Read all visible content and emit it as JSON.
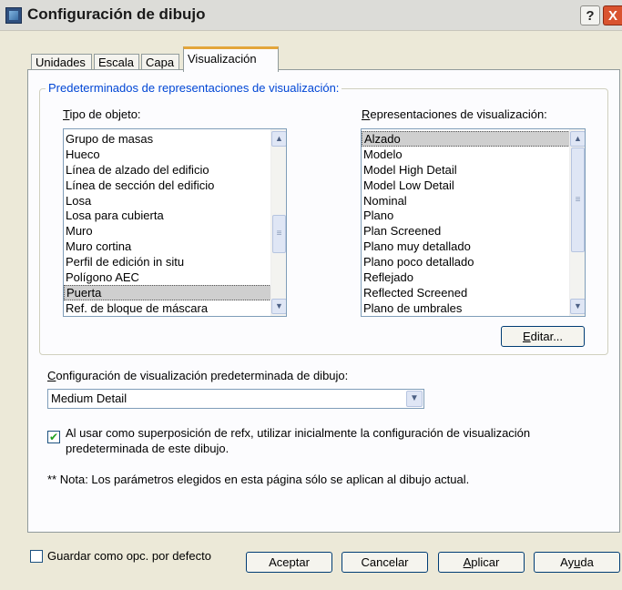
{
  "window": {
    "title": "Configuración de dibujo",
    "help_glyph": "?",
    "close_glyph": "X"
  },
  "tabs": [
    {
      "label": "Unidades",
      "active": false
    },
    {
      "label": "Escala",
      "active": false
    },
    {
      "label": "Capa",
      "active": false
    },
    {
      "label": "Visualización",
      "active": true
    }
  ],
  "group": {
    "title": "Predeterminados de representaciones de visualización:",
    "object_type_label": "Tipo de objeto:",
    "object_types": [
      "Grupo de masas",
      "Hueco",
      "Línea de alzado del edificio",
      "Línea de sección del edificio",
      "Losa",
      "Losa para cubierta",
      "Muro",
      "Muro cortina",
      "Perfil de edición in situ",
      "Polígono AEC",
      "Puerta",
      "Ref. de bloque de máscara"
    ],
    "object_type_selected_index": 10,
    "display_reps_label": "Representaciones de visualización:",
    "display_reps": [
      "Alzado",
      "Modelo",
      "Model High Detail",
      "Model Low Detail",
      "Nominal",
      "Plano",
      "Plan Screened",
      "Plano muy detallado",
      "Plano poco detallado",
      "Reflejado",
      "Reflected Screened",
      "Plano de umbrales"
    ],
    "display_rep_selected_index": 0,
    "edit_button": "Editar..."
  },
  "default_config": {
    "label": "Configuración de visualización predeterminada de dibujo:",
    "value": "Medium Detail"
  },
  "xref_checkbox": {
    "checked": true,
    "line1": "Al usar como superposición de refx, utilizar inicialmente la configuración de visualización",
    "line2": "predeterminada de este dibujo."
  },
  "note": "** Nota: Los parámetros elegidos en esta página sólo se aplican al dibujo actual.",
  "footer": {
    "save_default_label": "Guardar como opc. por defecto",
    "save_default_checked": false,
    "ok": "Aceptar",
    "cancel": "Cancelar",
    "apply": "Aplicar",
    "help": "Ayuda"
  },
  "colors": {
    "group_title": "#0046d5",
    "active_tab_accent": "#e3a63a",
    "selection": "#cfcfcf",
    "close_button": "#d9532f"
  },
  "icons": {
    "scroll_up": "▲",
    "scroll_down": "▼",
    "dropdown": "▼",
    "check": "✔"
  }
}
